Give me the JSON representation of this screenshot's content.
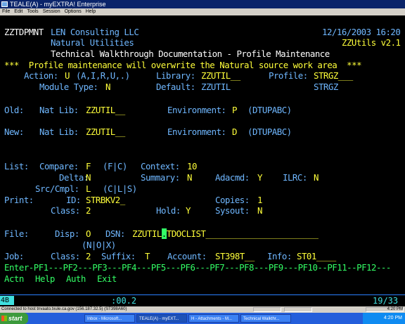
{
  "window": {
    "title": "TEALE(A) - myEXTRA! Enterprise",
    "menu": [
      "File",
      "Edit",
      "Tools",
      "Session",
      "Options",
      "Help"
    ]
  },
  "screen": {
    "program": "ZZTDPMNT",
    "company": "LEN Consulting LLC",
    "datetime": "12/16/2003 16:20",
    "subtitle": "Natural Utilities",
    "version": "ZZUtils v2.1",
    "heading": "Technical Walkthrough Documentation - Profile Maintenance",
    "warning": "***  Profile maintenance will overwrite the Natural source work area  ***",
    "action_label": "Action:",
    "action_value": "U",
    "action_options": "(A,I,R,U,.)",
    "library_label": "Library:",
    "library_value": "ZZUTIL__",
    "profile_label": "Profile:",
    "profile_value": "STRGZ___",
    "module_type_label": "Module Type:",
    "module_type_value": "N",
    "default_label": "Default:",
    "default_value": "ZZUTIL",
    "default_profile": "STRGZ",
    "old_label": "Old:",
    "old_natlib_label": "Nat Lib:",
    "old_natlib_value": "ZZUTIL__",
    "old_env_label": "Environment:",
    "old_env_value": "P",
    "old_env_options": "(DTUPABC)",
    "new_label": "New:",
    "new_natlib_label": "Nat Lib:",
    "new_natlib_value": "ZZUTIL__",
    "new_env_label": "Environment:",
    "new_env_value": "D",
    "new_env_options": "(DTUPABC)",
    "list_label": "List:",
    "compare_label": "Compare:",
    "compare_value": "F",
    "compare_options": "(F|C)",
    "context_label": "Context:",
    "context_value": "10",
    "delta_label": "Delta:",
    "delta_value": "N",
    "summary_label": "Summary:",
    "summary_value": "N",
    "adacmd_label": "Adacmd:",
    "adacmd_value": "Y",
    "ilrc_label": "ILRC:",
    "ilrc_value": "N",
    "srccmpl_label": "Src/Cmpl:",
    "srccmpl_value": "L",
    "srccmpl_options": "(C|L|S)",
    "print_label": "Print:",
    "id_label": "ID:",
    "id_value": "STRBKV2_",
    "copies_label": "Copies:",
    "copies_value": "1",
    "class_label": "Class:",
    "class_value": "2",
    "hold_label": "Hold:",
    "hold_value": "Y",
    "sysout_label": "Sysout:",
    "sysout_value": "N",
    "file_label": "File:",
    "disp_label": "Disp:",
    "disp_value": "O",
    "dsn_label": "DSN:",
    "dsn_value_a": "ZZUTIL",
    "dsn_cursor": ".",
    "dsn_value_b": "TDOCLIST_______________________",
    "disp_options": "(N|O|X)",
    "job_label": "Job:",
    "job_class_label": "Class:",
    "job_class_value": "2",
    "suffix_label": "Suffix:",
    "suffix_value": "T",
    "account_label": "Account:",
    "account_value": "ST398T__",
    "info_label": "Info:",
    "info_value": "ST01____",
    "pfkeys": "Enter-PF1---PF2---PF3---PF4---PF5---PF6---PF7---PF8---PF9---PF10--PF11--PF12---",
    "pf_actn": "Actn",
    "pf_help": "Help",
    "pf_auth": "Auth",
    "pf_exit": "Exit"
  },
  "oia": {
    "indicator": "4B",
    "clock": ":00.2",
    "cursor_pos": "19/33"
  },
  "statusbar": {
    "text": "Connected to host tnvaato.txule.ca.gov (156.187.32.5) (ST398A60)",
    "time": "4:20 PM"
  },
  "taskbar": {
    "start": "start",
    "tasks": [
      "Inbox - Microsoft...",
      "TEALE(A) - myEXT...",
      "H - Attachments - M...",
      "Technical Walkthr..."
    ],
    "clock": "4:20 PM"
  }
}
